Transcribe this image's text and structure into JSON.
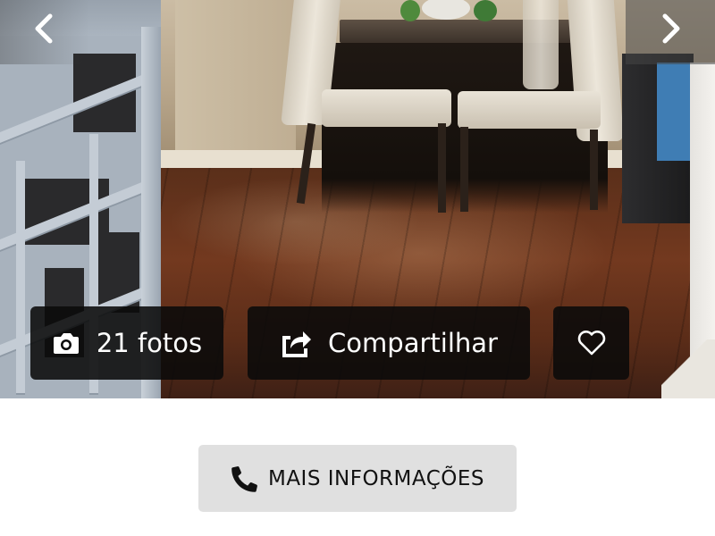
{
  "gallery": {
    "photo_count_label": "21 fotos",
    "share_label": "Compartilhar",
    "prev_icon": "chevron-left-icon",
    "next_icon": "chevron-right-icon",
    "camera_icon": "camera-icon",
    "share_icon": "share-icon",
    "favorite_icon": "heart-icon"
  },
  "actions": {
    "more_info_label": "MAIS INFORMAÇÕES",
    "more_info_icon": "phone-icon"
  },
  "colors": {
    "overlay_button_bg": "#0a0a0a",
    "overlay_text": "#ffffff",
    "more_info_bg": "#e0e0e0",
    "more_info_text": "#111111"
  }
}
